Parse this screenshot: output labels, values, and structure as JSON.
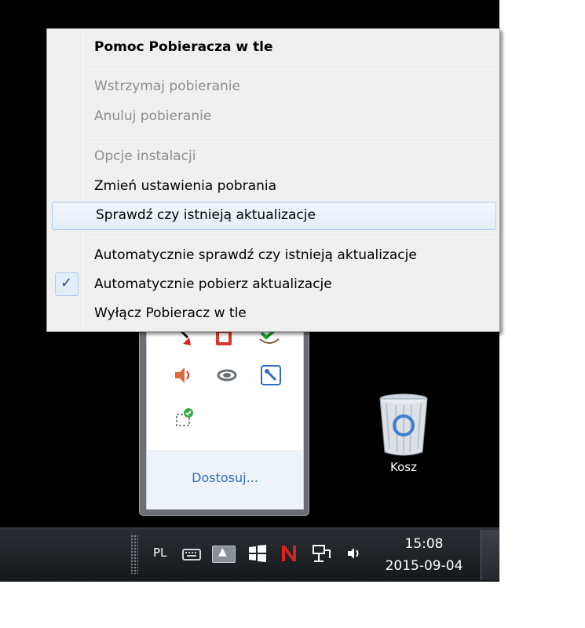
{
  "menu": {
    "title": "Pomoc Pobieracza w tle",
    "pause": "Wstrzymaj pobieranie",
    "cancel": "Anuluj pobieranie",
    "install_options": "Opcje instalacji",
    "change_settings": "Zmień ustawienia pobrania",
    "check_updates": "Sprawdź czy istnieją aktualizacje",
    "auto_check": "Automatycznie sprawdź czy istnieją aktualizacje",
    "auto_download": "Automatycznie pobierz aktualizacje",
    "auto_download_checked": true,
    "disable": "Wyłącz Pobieracz w tle",
    "check_glyph": "✓"
  },
  "tray_flyout": {
    "icons": [
      "arrow-app-icon",
      "office-icon",
      "green-check-shield-icon",
      "speaker-red-icon",
      "swirl-app-icon",
      "blue-tool-icon",
      "network-check-icon"
    ],
    "customize_label": "Dostosuj..."
  },
  "desktop": {
    "recycle_bin_label": "Kosz"
  },
  "taskbar": {
    "language": "PL",
    "show_hidden_glyph": "▲",
    "time": "15:08",
    "date": "2015-09-04"
  },
  "colors": {
    "taskbar": "#1e2226",
    "link": "#2f6fbf",
    "menu_bg": "#f0f0f0",
    "disabled_text": "#8d8d8d"
  }
}
